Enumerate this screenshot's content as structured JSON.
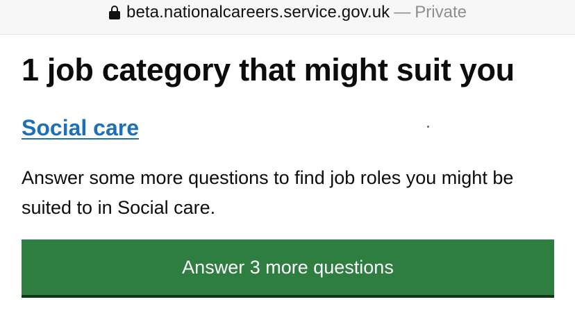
{
  "browser": {
    "url_domain": "beta.nationalcareers.service.gov.uk",
    "separator": "—",
    "mode_label": "Private"
  },
  "main": {
    "title": "1 job category that might suit you",
    "category_link": "Social care",
    "description": "Answer some more questions to find job roles you might be suited to in Social care.",
    "cta_label": "Answer 3 more questions"
  },
  "colors": {
    "link": "#1d70b8",
    "button": "#2e7d41",
    "button_shadow": "#0b3a18"
  }
}
